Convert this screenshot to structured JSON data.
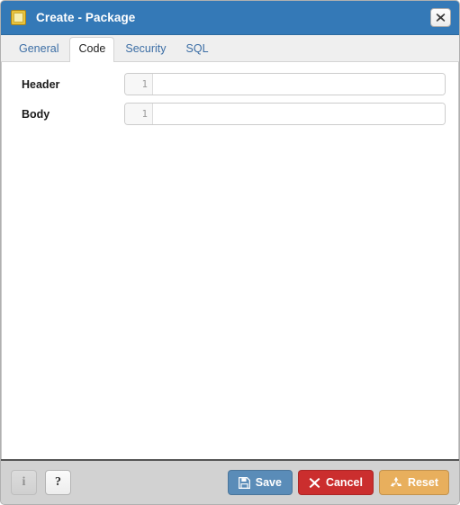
{
  "window": {
    "title": "Create - Package",
    "icon": "package-icon",
    "close_label": "✖",
    "accent_blue": "#3479b7"
  },
  "tabs": [
    {
      "label": "General",
      "active": false
    },
    {
      "label": "Code",
      "active": true
    },
    {
      "label": "Security",
      "active": false
    },
    {
      "label": "SQL",
      "active": false
    }
  ],
  "form": {
    "rows": [
      {
        "label": "Header",
        "line_number": "1",
        "value": ""
      },
      {
        "label": "Body",
        "line_number": "1",
        "value": ""
      }
    ]
  },
  "footer": {
    "info_label": "i",
    "help_label": "?",
    "save_label": "Save",
    "cancel_label": "Cancel",
    "reset_label": "Reset",
    "save_color": "#5a8cb8",
    "cancel_color": "#cb2e2e",
    "reset_color": "#e8af5d"
  }
}
